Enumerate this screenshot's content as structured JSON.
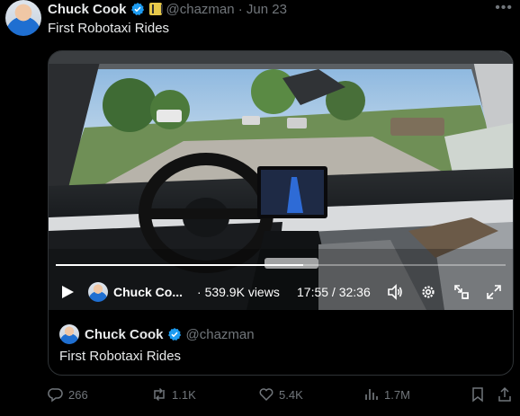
{
  "post": {
    "author_name": "Chuck Cook",
    "handle_date": "@chazman · Jun 23",
    "text": "First Robotaxi Rides"
  },
  "video": {
    "author_name": "Chuck Co...",
    "views": "539.9K views",
    "time": "17:55 / 32:36",
    "progress_fraction": 0.549
  },
  "quote": {
    "author_name": "Chuck Cook",
    "handle": "@chazman",
    "text": "First Robotaxi Rides"
  },
  "actions": {
    "replies": "266",
    "reposts": "1.1K",
    "likes": "5.4K",
    "views": "1.7M"
  },
  "colors": {
    "verified": "#1d9bf0",
    "muted": "#71767b",
    "text": "#e7e9ea",
    "border": "#2f3336"
  },
  "icons": [
    "verified-badge-icon",
    "affiliate-badge-icon",
    "more-icon",
    "play-icon",
    "volume-icon",
    "settings-icon",
    "picture-in-picture-icon",
    "fullscreen-icon",
    "reply-icon",
    "repost-icon",
    "like-icon",
    "views-icon",
    "bookmark-icon",
    "share-icon"
  ]
}
